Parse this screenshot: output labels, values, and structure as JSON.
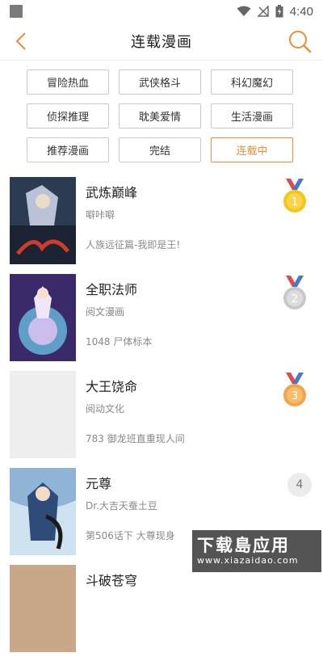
{
  "status_bar": {
    "time": "4:40"
  },
  "header": {
    "title": "连载漫画"
  },
  "tags": [
    {
      "label": "冒险热血",
      "active": false
    },
    {
      "label": "武侠格斗",
      "active": false
    },
    {
      "label": "科幻魔幻",
      "active": false
    },
    {
      "label": "侦探推理",
      "active": false
    },
    {
      "label": "耽美爱情",
      "active": false
    },
    {
      "label": "生活漫画",
      "active": false
    },
    {
      "label": "推荐漫画",
      "active": false
    },
    {
      "label": "完结",
      "active": false
    },
    {
      "label": "连载中",
      "active": true
    }
  ],
  "list": [
    {
      "name": "武炼巅峰",
      "author": "噼咔噼",
      "desc": "人族远征篇-我即是王!",
      "rank": "1",
      "rank_style": "gold",
      "cover_color": "#2d3b52"
    },
    {
      "name": "全职法师",
      "author": "阅文漫画",
      "desc": "1048 尸体标本",
      "rank": "2",
      "rank_style": "silver",
      "cover_color": "#3a2a6a"
    },
    {
      "name": "大王饶命",
      "author": "阅动文化",
      "desc": "783 御龙班直重现人间",
      "rank": "3",
      "rank_style": "bronze",
      "cover_color": "#eeeeee"
    },
    {
      "name": "元尊",
      "author": "Dr.大吉天蚕土豆",
      "desc": "第506话下 大尊现身",
      "rank": "4",
      "rank_style": "plain",
      "cover_color": "#5a7fa8"
    },
    {
      "name": "斗破苍穹",
      "author": "",
      "desc": "",
      "rank": "",
      "rank_style": "none",
      "cover_color": "#c9a88a"
    }
  ],
  "watermark": {
    "top": "下载島应用",
    "bottom": "www.xiazaidao.com"
  },
  "colors": {
    "accent": "#f08c3a",
    "gold": "#f5c518",
    "silver": "#c8c8c8",
    "bronze": "#f3a44a"
  }
}
